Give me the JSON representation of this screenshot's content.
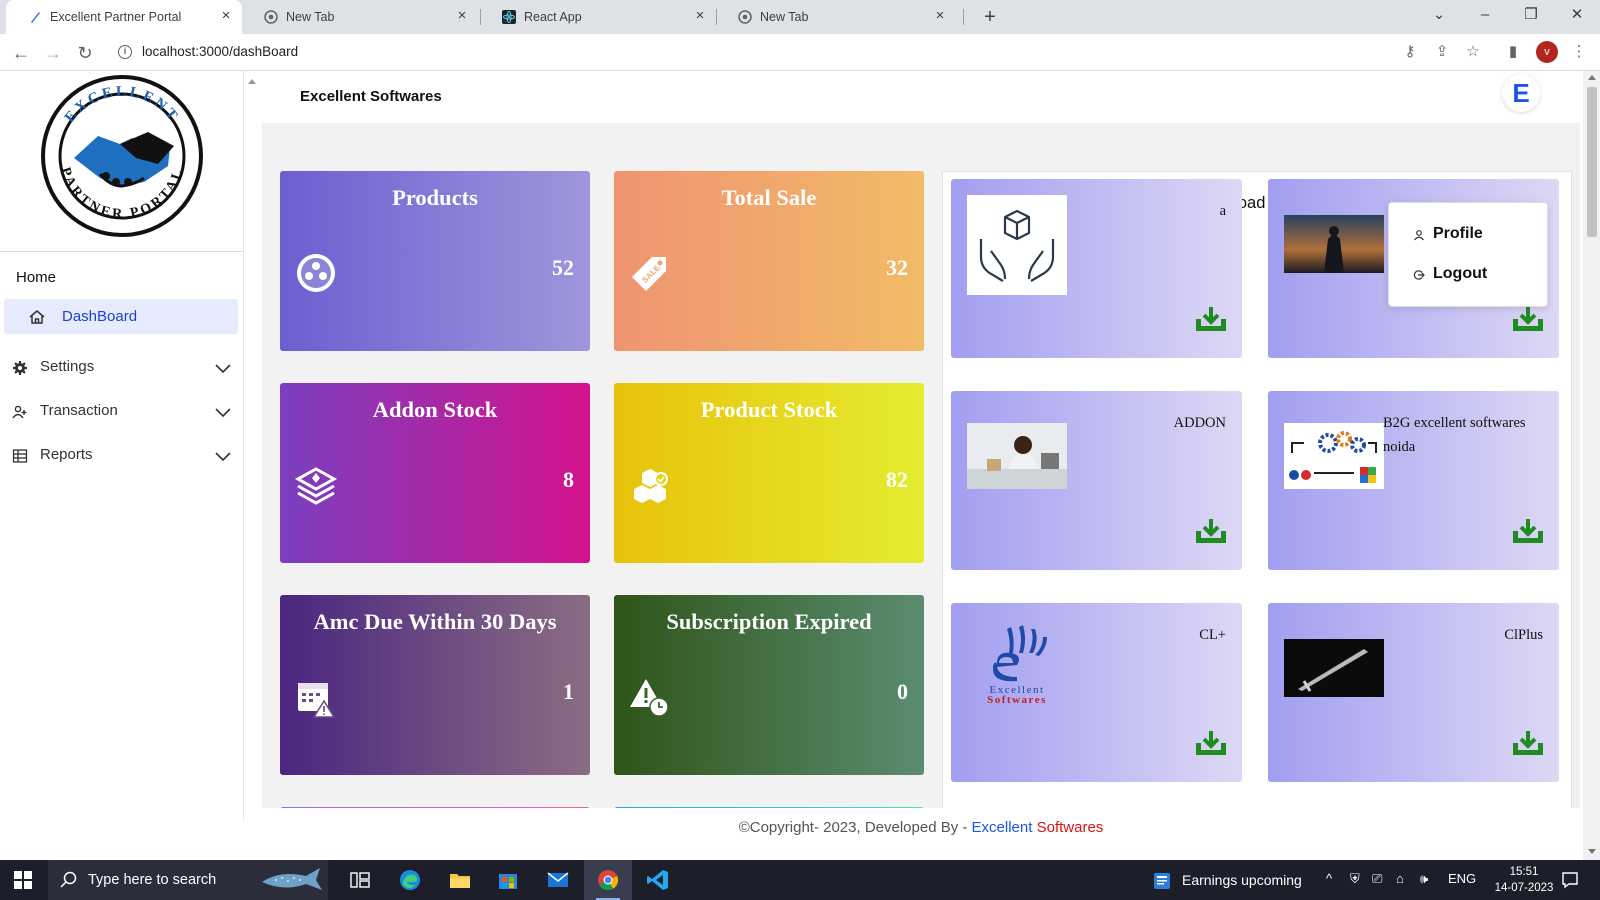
{
  "browser": {
    "tabs": [
      {
        "label": "Excellent Partner Portal",
        "active": true
      },
      {
        "label": "New Tab",
        "active": false
      },
      {
        "label": "React App",
        "active": false
      },
      {
        "label": "New Tab",
        "active": false
      }
    ],
    "url": "localhost:3000/dashBoard",
    "profile_initial": "v"
  },
  "sidebar": {
    "logo_text_top": "EXCELLENT",
    "logo_text_bottom": "PARTNER PORTAL",
    "home_label": "Home",
    "dashboard_label": "DashBoard",
    "items": [
      {
        "label": "Settings",
        "icon": "gear-icon"
      },
      {
        "label": "Transaction",
        "icon": "user-add-icon"
      },
      {
        "label": "Reports",
        "icon": "table-icon"
      }
    ]
  },
  "header": {
    "brand": "Excellent Softwares",
    "user_initial": "E"
  },
  "stats": [
    {
      "title": "Products",
      "value": "52",
      "icon": "products-icon"
    },
    {
      "title": "Total Sale",
      "value": "32",
      "icon": "sale-tag-icon"
    },
    {
      "title": "Addon Stock",
      "value": "8",
      "icon": "layers-icon"
    },
    {
      "title": "Product Stock",
      "value": "82",
      "icon": "boxes-icon"
    },
    {
      "title": "Amc Due Within 30 Days",
      "value": "1",
      "icon": "calendar-alert-icon"
    },
    {
      "title": "Subscription Expired",
      "value": "0",
      "icon": "warning-clock-icon"
    }
  ],
  "downloads": {
    "heading": "Download Setup",
    "items": [
      {
        "name": "a",
        "thumb": "hands-box-thumb"
      },
      {
        "name": "",
        "thumb": "warrior-thumb"
      },
      {
        "name": "ADDON",
        "thumb": "office-woman-thumb"
      },
      {
        "name": "B2G excellent softwares noida",
        "thumb": "gears-network-thumb"
      },
      {
        "name": "CL+",
        "thumb": "excellent-logo-thumb"
      },
      {
        "name": "ClPlus",
        "thumb": "sword-thumb"
      }
    ]
  },
  "user_menu": {
    "items": [
      {
        "label": "Profile",
        "icon": "user-icon"
      },
      {
        "label": "Logout",
        "icon": "logout-icon"
      }
    ]
  },
  "footer": {
    "prefix": "©Copyright- 2023, Developed By - ",
    "link1": "Excellent",
    "link2": "Softwares"
  },
  "taskbar": {
    "search_placeholder": "Type here to search",
    "news": "Earnings upcoming",
    "lang": "ENG",
    "time": "15:51",
    "date": "14-07-2023"
  },
  "colors": {
    "accent": "#1a56e8",
    "active_bg": "#e6ecfd",
    "download_green": "#1e8c1e"
  }
}
